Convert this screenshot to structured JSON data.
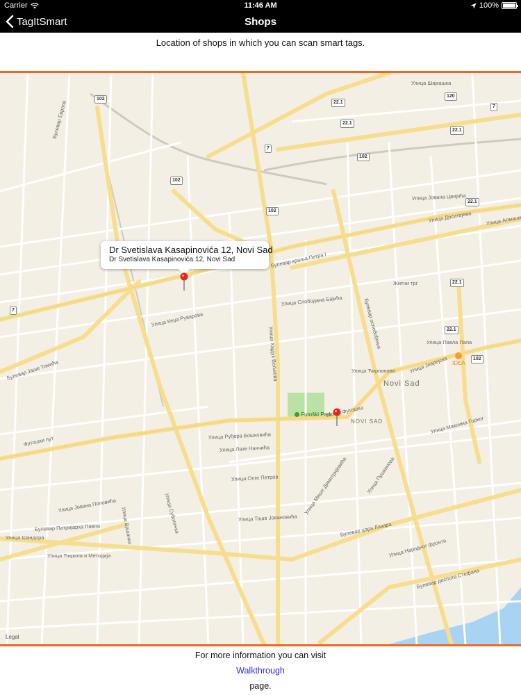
{
  "status_bar": {
    "carrier": "Carrier",
    "time": "11:46 AM",
    "battery": "100%",
    "battery_level": 1.0
  },
  "nav": {
    "back_label": "TagItSmart",
    "title": "Shops"
  },
  "subtitle": "Location of shops in which you can scan smart tags.",
  "map": {
    "legal": "Legal",
    "callout": {
      "title": "Dr Svetislava Kasapinovića 12, Novi Sad",
      "subtitle": "Dr Svetislava Kasapinovića 12, Novi Sad"
    },
    "park": "Futoški Park",
    "poi": "IDEA",
    "districts": [
      "NOVI SAD",
      "Novi Sad"
    ],
    "route_shields": [
      "102",
      "102",
      "102",
      "7",
      "7",
      "7",
      "22.1",
      "22.1",
      "22.1",
      "22.1",
      "22.1",
      "22.1",
      "102",
      "120"
    ],
    "streets": [
      "Улица Шајкашка",
      "Булевар Европе",
      "Улица Јована Цвијића",
      "Улица Доситејева",
      "Булевар краља Петра I",
      "Улица Кеџа Руварова",
      "Улица Слободана Бајића",
      "Житни трг",
      "Улица Хајдук Вељкова",
      "Улица Јеврејска",
      "Улица Ћирпанова",
      "Булевар ослобођења",
      "Улица Футошка",
      "Улица Руђера Бошковића",
      "Улица Лазе Нанчића",
      "Улица Олге Петров",
      "Улица Тоше Јовановића",
      "Улица Максима Горког",
      "Улица Пушкинова",
      "Улица Мише Димитријевића",
      "Булевар цара Лазара",
      "Булевар Патријарха Павла",
      "Улица Народног фронта",
      "Булевар деспота Стефана",
      "Улица Ћирила и Методија",
      "Футошки пут",
      "Булевар Јаше Томића",
      "Улица Јована Поповића",
      "Улица Суботичка",
      "Улица Шандора",
      "Улица Вршачка",
      "Улица Павла Папа",
      "Улица Алмашка"
    ]
  },
  "footer": {
    "line1": "For more information you can visit",
    "link": "Walkthrough",
    "line3": "page."
  },
  "colors": {
    "accent": "#f2661f",
    "link": "#2a2ad6",
    "map_bg": "#f3efe4",
    "road_major": "#f7dd8e",
    "park": "#b9e2a4",
    "water": "#a9d3f2",
    "pin": "#e5251f"
  }
}
